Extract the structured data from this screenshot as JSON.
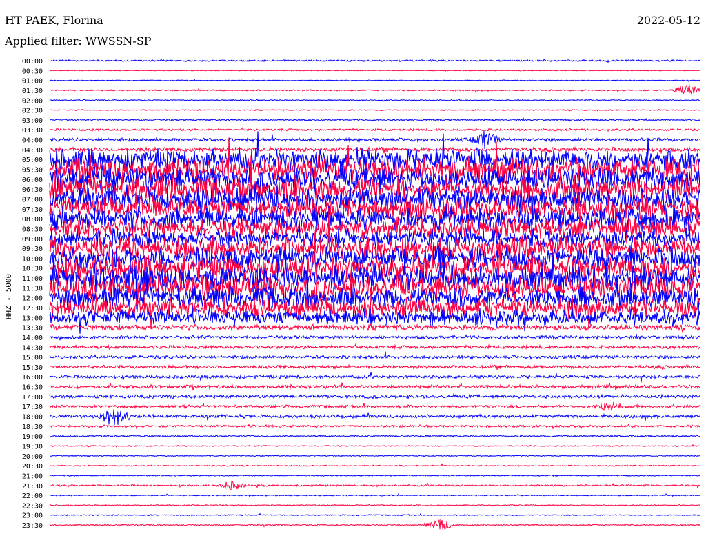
{
  "header": {
    "title": "HT PAEK, Florina",
    "date": "2022-05-12",
    "filter": "Applied filter: WWSSN-SP"
  },
  "chart_data": {
    "type": "line",
    "title": "HT PAEK, Florina",
    "subtitle": "Applied filter: WWSSN-SP",
    "ylabel": "HHZ - 5000",
    "colors": [
      "#0000ff",
      "#ff0040"
    ],
    "rows": [
      "00:00",
      "00:30",
      "01:00",
      "01:30",
      "02:00",
      "02:30",
      "03:00",
      "03:30",
      "04:00",
      "04:30",
      "05:00",
      "05:30",
      "06:00",
      "06:30",
      "07:00",
      "07:30",
      "08:00",
      "08:30",
      "09:00",
      "09:30",
      "10:00",
      "10:30",
      "11:00",
      "11:30",
      "12:00",
      "12:30",
      "13:00",
      "13:30",
      "14:00",
      "14:30",
      "15:00",
      "15:30",
      "16:00",
      "16:30",
      "17:00",
      "17:30",
      "18:00",
      "18:30",
      "19:00",
      "19:30",
      "20:00",
      "20:30",
      "21:00",
      "21:30",
      "22:00",
      "22:30",
      "23:00",
      "23:30"
    ],
    "relative_amplitude": [
      1.5,
      0.6,
      0.8,
      1.2,
      1,
      1,
      1.5,
      2,
      3,
      4,
      20,
      22,
      22,
      22,
      22,
      20,
      20,
      18,
      16,
      20,
      20,
      22,
      22,
      22,
      20,
      18,
      14,
      5,
      3,
      3,
      3,
      3,
      3,
      3,
      3,
      2.5,
      3,
      2,
      1.5,
      1,
      1,
      1,
      1,
      1.5,
      1,
      1,
      1,
      1.2
    ],
    "events": [
      {
        "row": "01:30",
        "position": 0.98,
        "amplitude": 8
      },
      {
        "row": "18:00",
        "position": 0.1,
        "amplitude": 14
      },
      {
        "row": "21:30",
        "position": 0.28,
        "amplitude": 6
      },
      {
        "row": "23:30",
        "position": 0.6,
        "amplitude": 8
      },
      {
        "row": "17:30",
        "position": 0.86,
        "amplitude": 7
      },
      {
        "row": "04:00",
        "position": 0.67,
        "amplitude": 12
      }
    ]
  }
}
